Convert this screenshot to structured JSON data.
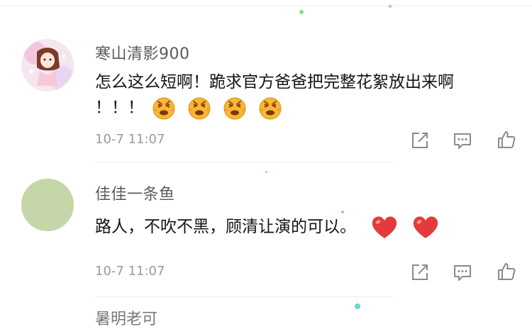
{
  "comments": [
    {
      "username": "寒山清影900",
      "text_line1": "怎么这么短啊！跪求官方爸爸把完整花絮放出来啊",
      "text_line2": "！！！",
      "emoji_icons": [
        "persevere-face-icon",
        "persevere-face-icon",
        "persevere-face-icon",
        "persevere-face-icon"
      ],
      "timestamp": "10-7 11:07",
      "avatar_icon": "anime-avatar-icon"
    },
    {
      "username": "佳佳一条鱼",
      "text": "路人，不吹不黑，顾清让演的可以。",
      "emoji_icons": [
        "red-heart-icon",
        "red-heart-icon"
      ],
      "timestamp": "10-7 11:07",
      "avatar_icon": "plain-avatar-icon"
    }
  ],
  "next_comment_username_peek": "暑明老可",
  "actions": [
    "share-icon",
    "reply-icon",
    "like-icon"
  ],
  "colors": {
    "avatar_green": "#c5d6a8",
    "heart_red": "#e33b3b",
    "emoji_yellow": "#f7b733",
    "icon_gray": "#8a8a8a"
  }
}
